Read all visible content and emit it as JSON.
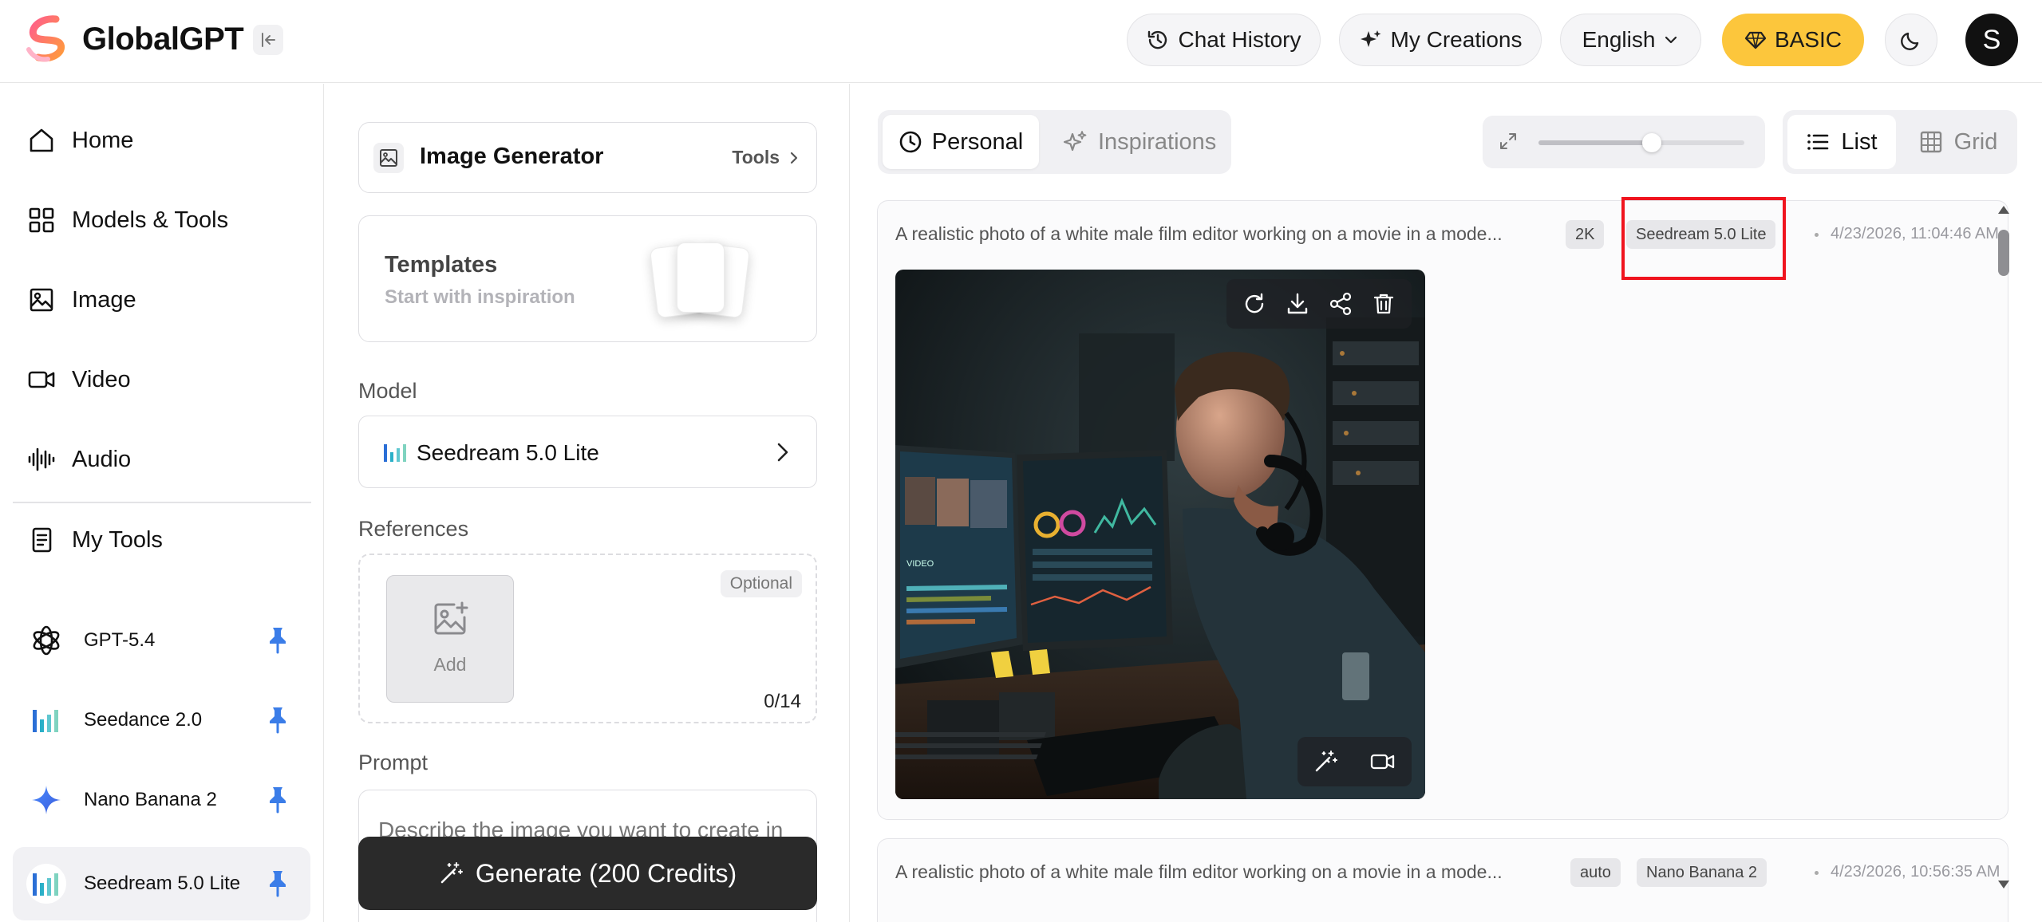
{
  "header": {
    "brand": "GlobalGPT",
    "chat_history": "Chat History",
    "my_creations": "My Creations",
    "language": "English",
    "plan": "BASIC",
    "avatar_initial": "S"
  },
  "sidebar": {
    "nav": [
      {
        "label": "Home",
        "icon": "home-icon"
      },
      {
        "label": "Models & Tools",
        "icon": "grid-icon"
      },
      {
        "label": "Image",
        "icon": "image-icon"
      },
      {
        "label": "Video",
        "icon": "video-icon"
      },
      {
        "label": "Audio",
        "icon": "audio-wave-icon"
      },
      {
        "label": "My Tools",
        "icon": "document-icon"
      }
    ],
    "pinned": [
      {
        "label": "GPT-5.4",
        "icon": "openai-icon"
      },
      {
        "label": "Seedance 2.0",
        "icon": "bars-chart-icon"
      },
      {
        "label": "Nano Banana 2",
        "icon": "sparkle-icon"
      },
      {
        "label": "Seedream 5.0 Lite",
        "icon": "bars-chart-icon",
        "active": true
      }
    ]
  },
  "generator": {
    "title": "Image Generator",
    "tools_link": "Tools",
    "templates_title": "Templates",
    "templates_subtitle": "Start with inspiration",
    "model_label": "Model",
    "model_value": "Seedream 5.0 Lite",
    "references_label": "References",
    "add_label": "Add",
    "optional_badge": "Optional",
    "ref_count": "0/14",
    "prompt_label": "Prompt",
    "prompt_placeholder": "Describe the image you want to create in",
    "generate_label": "Generate (200 Credits)"
  },
  "results": {
    "tabs": {
      "personal": "Personal",
      "inspirations": "Inspirations"
    },
    "zoom_level": 0.55,
    "view": {
      "list": "List",
      "grid": "Grid"
    },
    "items": [
      {
        "prompt": "A realistic photo of a white male film editor working on a movie in a mode...",
        "resolution": "2K",
        "model": "Seedream 5.0 Lite",
        "timestamp": "4/23/2026, 11:04:46 AM"
      },
      {
        "prompt": "A realistic photo of a white male film editor working on a movie in a mode...",
        "resolution": "auto",
        "model": "Nano Banana 2",
        "timestamp": "4/23/2026, 10:56:35 AM"
      }
    ],
    "image_screen_label": "VIDEO"
  },
  "colors": {
    "accent_yellow": "#fcc63c",
    "highlight_red": "#f0141e",
    "pin_blue": "#3b7de8",
    "dark_button": "#2a2a2a"
  }
}
